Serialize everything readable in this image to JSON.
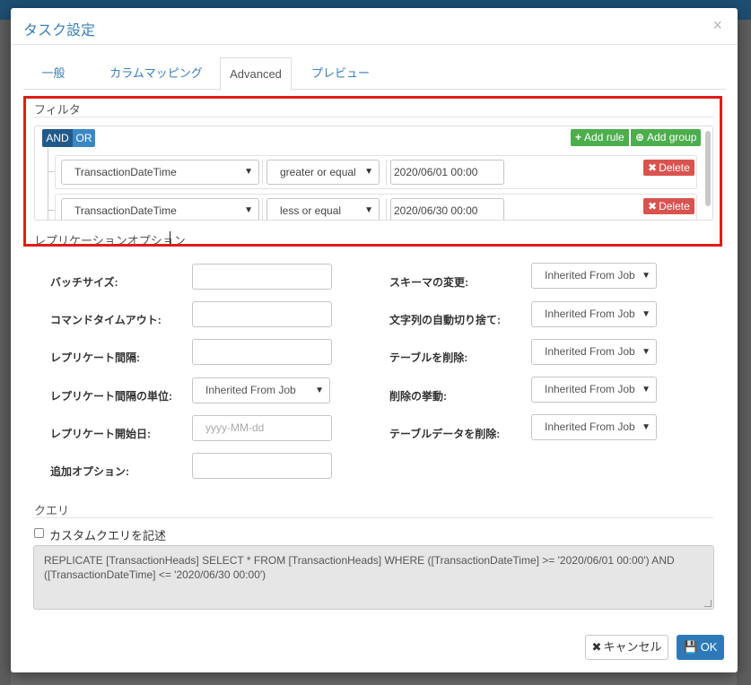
{
  "dialog": {
    "title": "タスク設定",
    "close_glyph": "×"
  },
  "tabs": [
    {
      "label": "一般",
      "active": false
    },
    {
      "label": "カラムマッピング",
      "active": false
    },
    {
      "label": "Advanced",
      "active": true
    },
    {
      "label": "プレビュー",
      "active": false
    }
  ],
  "filter": {
    "section_label": "フィルタ",
    "conditions": {
      "and": "AND",
      "or": "OR",
      "selected": "AND"
    },
    "add_rule_label": "Add rule",
    "add_group_label": "Add group",
    "rules": [
      {
        "field": "TransactionDateTime",
        "operator": "greater or equal",
        "value": "2020/06/01 00:00",
        "delete_label": "Delete"
      },
      {
        "field": "TransactionDateTime",
        "operator": "less or equal",
        "value": "2020/06/30 00:00",
        "delete_label": "Delete"
      }
    ]
  },
  "replication": {
    "section_label": "レプリケーションオプション",
    "left_fields": [
      {
        "label": "バッチサイズ:",
        "value": ""
      },
      {
        "label": "コマンドタイムアウト:",
        "value": ""
      },
      {
        "label": "レプリケート間隔:",
        "value": ""
      },
      {
        "label": "レプリケート間隔の単位:",
        "value": "Inherited From Job"
      },
      {
        "label": "レプリケート開始日:",
        "placeholder": "yyyy-MM-dd"
      },
      {
        "label": "追加オプション:",
        "value": ""
      }
    ],
    "right_fields": [
      {
        "label": "スキーマの変更:",
        "value": "Inherited From Job"
      },
      {
        "label": "文字列の自動切り捨て:",
        "value": "Inherited From Job"
      },
      {
        "label": "テーブルを削除:",
        "value": "Inherited From Job"
      },
      {
        "label": "削除の挙動:",
        "value": "Inherited From Job"
      },
      {
        "label": "テーブルデータを削除:",
        "value": "Inherited From Job"
      }
    ]
  },
  "query": {
    "section_label": "クエリ",
    "custom_query_label": "カスタムクエリを記述",
    "custom_query_checked": false,
    "text": "REPLICATE [TransactionHeads] SELECT * FROM [TransactionHeads] WHERE ([TransactionDateTime] >= '2020/06/01 00:00') AND ([TransactionDateTime] <= '2020/06/30 00:00')"
  },
  "footer": {
    "cancel_label": "キャンセル",
    "ok_label": "OK"
  },
  "colors": {
    "accent": "#2e7ab8",
    "highlight_border": "#e21b1b",
    "success": "#4cae4c",
    "danger": "#d9534f"
  }
}
